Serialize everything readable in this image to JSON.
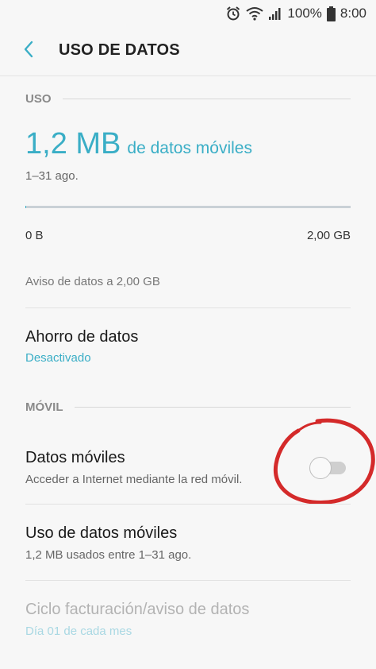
{
  "status_bar": {
    "battery": "100%",
    "time": "8:00",
    "icons": [
      "alarm-icon",
      "wifi-icon",
      "signal-icon",
      "battery-icon"
    ]
  },
  "appbar": {
    "title": "USO DE DATOS"
  },
  "usage_section": {
    "header": "USO",
    "amount": "1,2 MB",
    "amount_suffix": "de datos móviles",
    "period": "1–31 ago.",
    "range_min": "0 B",
    "range_max": "2,00 GB",
    "fill_fraction": 0.0006,
    "warning": "Aviso de datos a 2,00 GB"
  },
  "data_saver": {
    "title": "Ahorro de datos",
    "status": "Desactivado"
  },
  "mobile_section": {
    "header": "MÓVIL",
    "mobile_data": {
      "title": "Datos móviles",
      "subtitle": "Acceder a Internet mediante la red móvil.",
      "enabled": false
    },
    "mobile_usage": {
      "title": "Uso de datos móviles",
      "subtitle": "1,2 MB usados entre 1–31 ago."
    },
    "billing_cycle": {
      "title": "Ciclo facturación/aviso de datos",
      "subtitle": "Día 01 de cada mes",
      "disabled": true
    }
  },
  "colors": {
    "accent": "#3aaec6",
    "annotation": "#d42a2a",
    "background": "#f7f7f7"
  }
}
